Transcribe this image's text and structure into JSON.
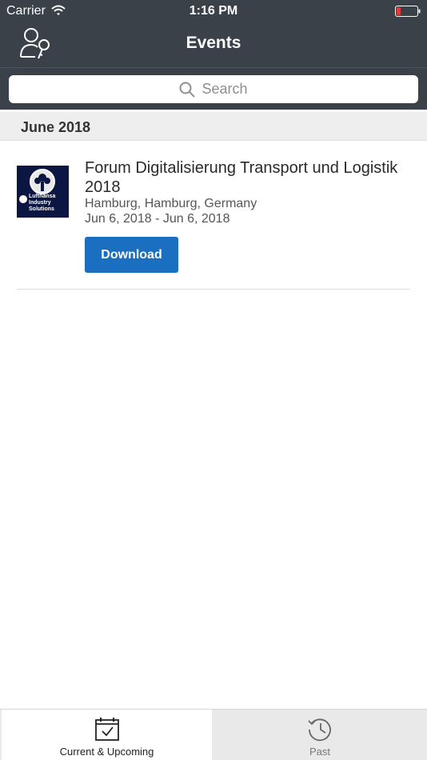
{
  "status_bar": {
    "carrier": "Carrier",
    "time": "1:16 PM",
    "battery_color": "#e53935"
  },
  "nav": {
    "title": "Events",
    "left_icon": "user-key-icon"
  },
  "search": {
    "placeholder": "Search",
    "icon": "search-icon"
  },
  "sections": [
    {
      "header": "June 2018",
      "events": [
        {
          "logo_text": "Lufthansa Industry Solutions",
          "name": "Forum Digitalisierung Transport und Logistik 2018",
          "location": "Hamburg, Hamburg, Germany",
          "dates": "Jun 6, 2018 - Jun 6, 2018",
          "action_label": "Download"
        }
      ]
    }
  ],
  "tabs": [
    {
      "label": "Current & Upcoming",
      "icon": "calendar-check-icon",
      "active": true
    },
    {
      "label": "Past",
      "icon": "history-clock-icon",
      "active": false
    }
  ],
  "colors": {
    "header_bg": "#3a4149",
    "accent": "#1a6fc0",
    "section_bg": "#eeeeee",
    "logo_bg": "#0b1642"
  }
}
